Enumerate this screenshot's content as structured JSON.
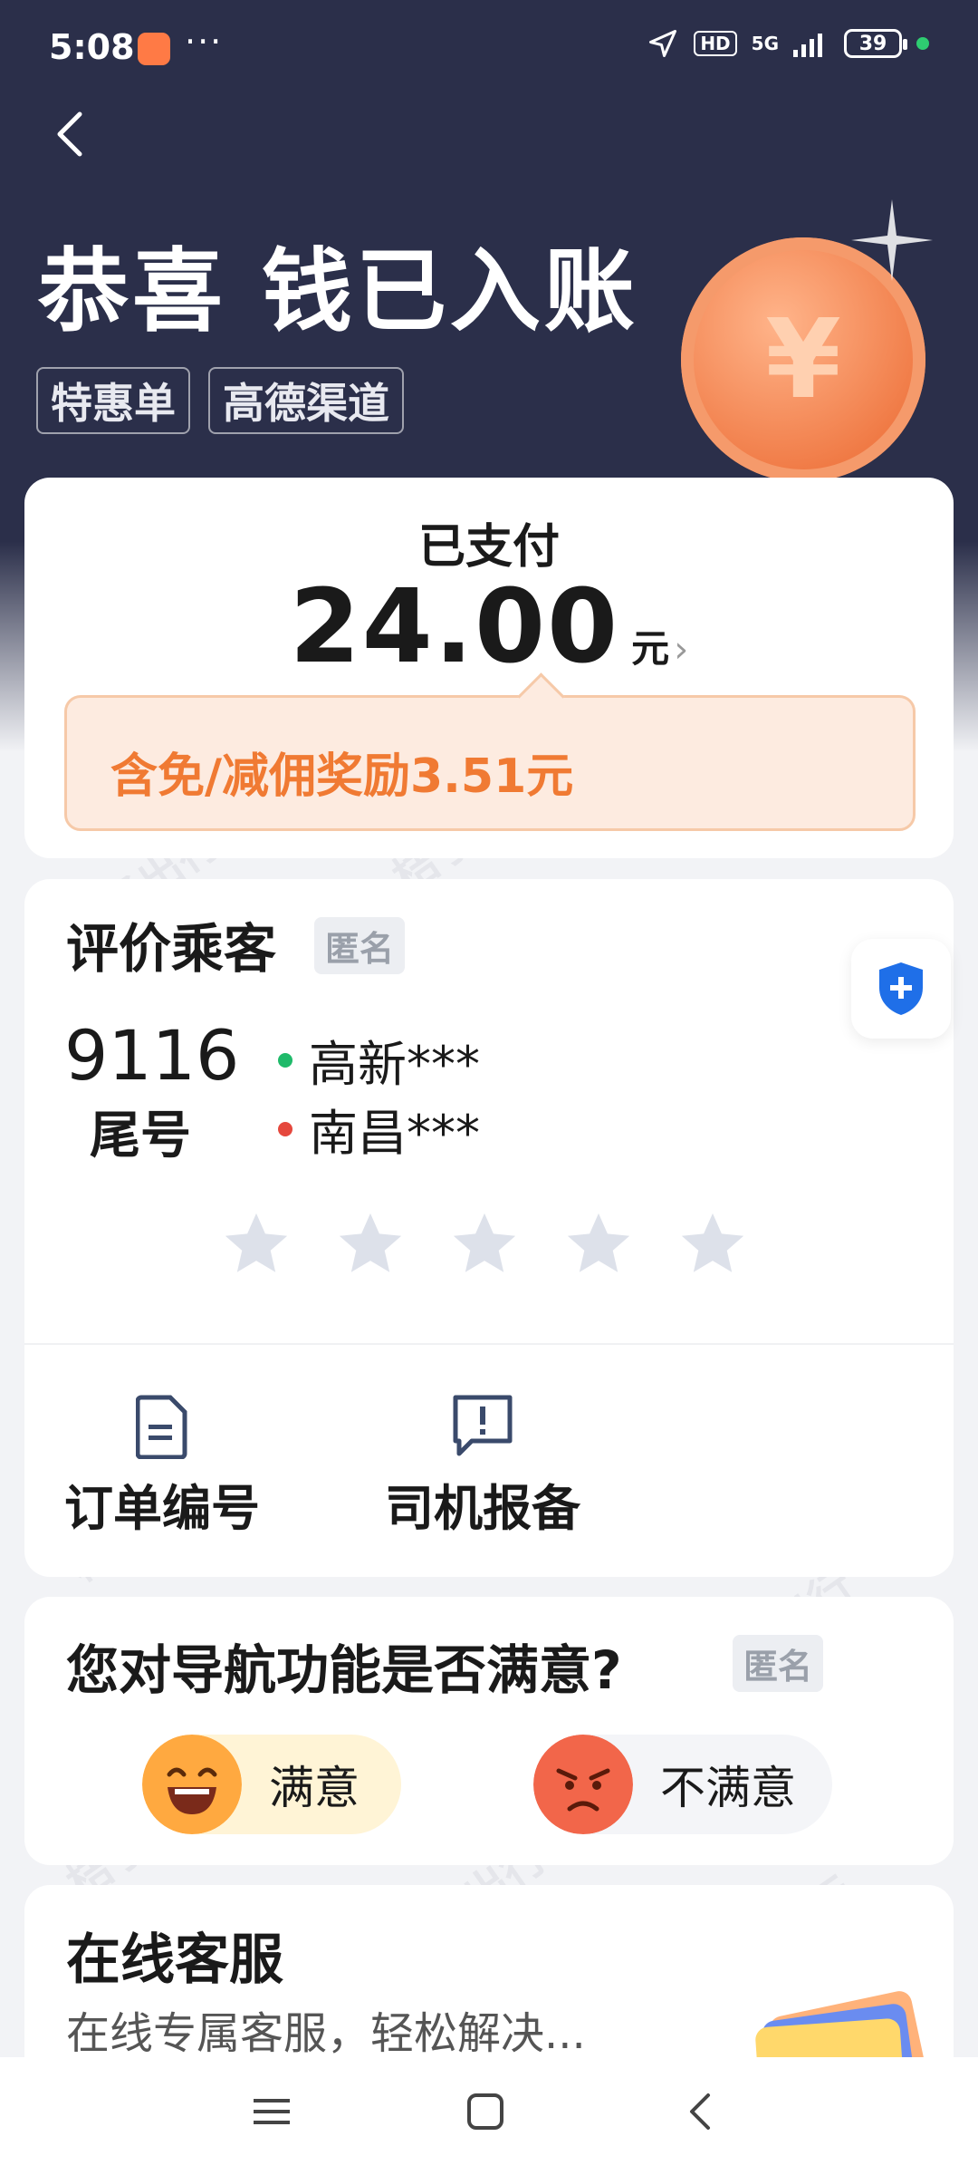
{
  "status_bar": {
    "time": "5:08",
    "more": "···",
    "hd": "HD",
    "network": "5G",
    "battery": "39"
  },
  "header": {
    "title": "恭喜 钱已入账",
    "tags": [
      "特惠单",
      "高德渠道"
    ],
    "coin_symbol": "¥"
  },
  "payment": {
    "paid_label": "已支付",
    "amount": "24.00",
    "unit": "元",
    "chevron": "›",
    "reward_text": "含免/减佣奖励3.51元"
  },
  "rating": {
    "title": "评价乘客",
    "anonymous_tag": "匿名",
    "tail_number": "9116",
    "tail_label": "尾号",
    "origin": "高新***",
    "destination": "南昌***",
    "stars_selected": 0,
    "stars_total": 5,
    "actions": [
      {
        "label": "订单编号",
        "icon": "document-icon"
      },
      {
        "label": "司机报备",
        "icon": "report-icon"
      }
    ]
  },
  "navigation_survey": {
    "question": "您对导航功能是否满意?",
    "anonymous_tag": "匿名",
    "satisfied": "满意",
    "unsatisfied": "不满意"
  },
  "customer_service": {
    "title": "在线客服",
    "subtitle": "在线专属客服，轻松解决..."
  },
  "watermark": "桔子出行",
  "colors": {
    "header_bg": "#2b2f4a",
    "accent_orange": "#f07a33",
    "origin_dot": "#1fba6a",
    "destination_dot": "#e5483d",
    "shield_blue": "#1f6fe8"
  }
}
